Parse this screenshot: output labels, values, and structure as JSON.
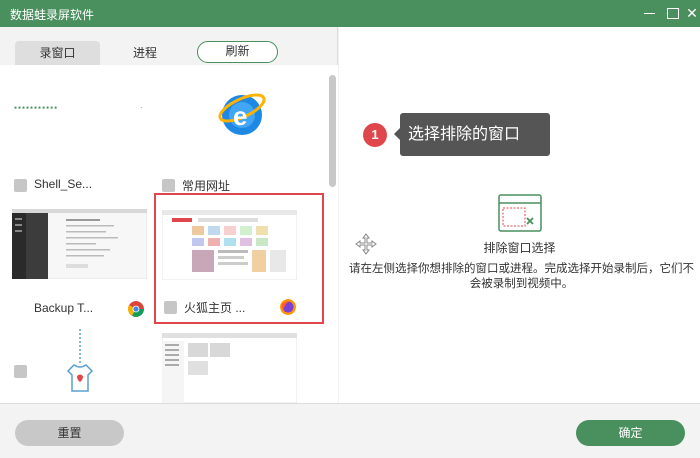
{
  "window": {
    "title": "数据蛙录屏软件",
    "close_glyph": "✕"
  },
  "tabs": {
    "record_window": "录窗口",
    "process": "进程",
    "refresh": "刷新"
  },
  "items": [
    {
      "label": "Shell_Se...",
      "thumb_text": "▪▪▪▪▪▪▪▪▪▪▪",
      "thumb_dot": "·"
    },
    {
      "label": "常用网址",
      "icon_letter": "e"
    },
    {
      "label": "Backup T...",
      "browser": "chrome"
    },
    {
      "label": "火狐主页 ...",
      "browser": "firefox"
    }
  ],
  "right": {
    "step_number": "1",
    "tip": "选择排除的窗口",
    "exclude_title": "排除窗口选择",
    "exclude_desc": "请在左侧选择你想排除的窗口或进程。完成选择开始录制后，它们不会被录制到视频中。"
  },
  "buttons": {
    "reset": "重置",
    "ok": "确定"
  },
  "colors": {
    "accent": "#4a8f5e",
    "highlight": "#e0474c"
  }
}
